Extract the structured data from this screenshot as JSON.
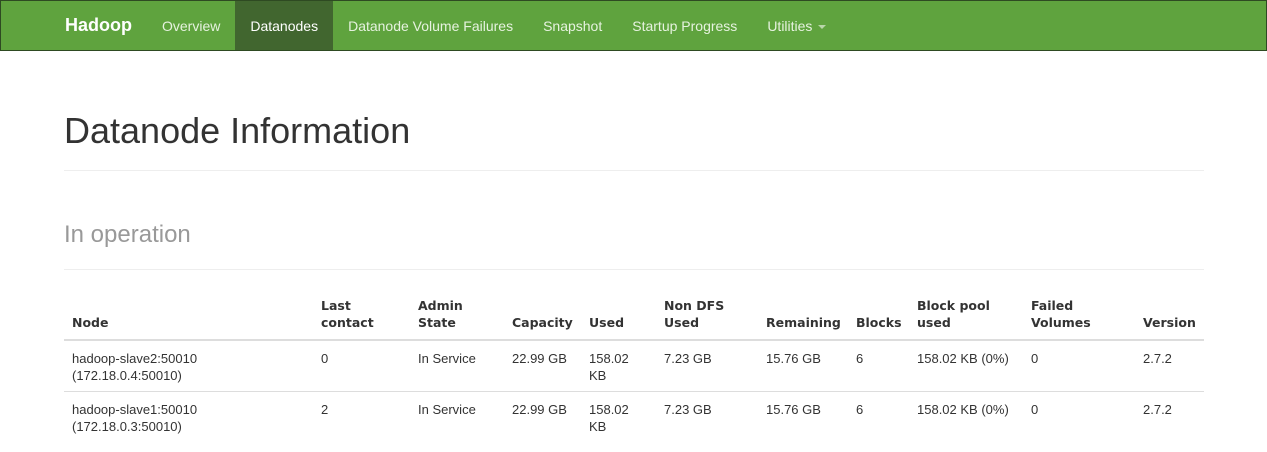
{
  "navbar": {
    "brand": "Hadoop",
    "items": [
      {
        "label": "Overview"
      },
      {
        "label": "Datanodes",
        "active": true
      },
      {
        "label": "Datanode Volume Failures"
      },
      {
        "label": "Snapshot"
      },
      {
        "label": "Startup Progress"
      },
      {
        "label": "Utilities"
      }
    ]
  },
  "page": {
    "title": "Datanode Information",
    "section": "In operation"
  },
  "table": {
    "headers": [
      "Node",
      "Last contact",
      "Admin State",
      "Capacity",
      "Used",
      "Non DFS Used",
      "Remaining",
      "Blocks",
      "Block pool used",
      "Failed Volumes",
      "Version"
    ],
    "rows": [
      {
        "node": "hadoop-slave2:50010 (172.18.0.4:50010)",
        "last_contact": "0",
        "admin_state": "In Service",
        "capacity": "22.99 GB",
        "used": "158.02 KB",
        "non_dfs_used": "7.23 GB",
        "remaining": "15.76 GB",
        "blocks": "6",
        "block_pool_used": "158.02 KB (0%)",
        "failed_volumes": "0",
        "version": "2.7.2"
      },
      {
        "node": "hadoop-slave1:50010 (172.18.0.3:50010)",
        "last_contact": "2",
        "admin_state": "In Service",
        "capacity": "22.99 GB",
        "used": "158.02 KB",
        "non_dfs_used": "7.23 GB",
        "remaining": "15.76 GB",
        "blocks": "6",
        "block_pool_used": "158.02 KB (0%)",
        "failed_volumes": "0",
        "version": "2.7.2"
      }
    ]
  }
}
